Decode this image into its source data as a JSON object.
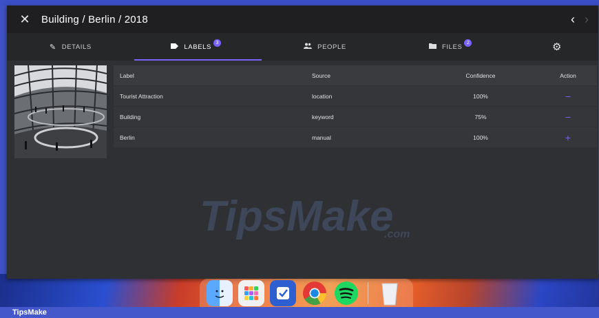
{
  "window": {
    "title": "Building / Berlin / 2018"
  },
  "tabs": [
    {
      "label": "DETAILS",
      "icon": "pencil-icon",
      "badge": ""
    },
    {
      "label": "LABELS",
      "icon": "label-tag-icon",
      "badge": "3"
    },
    {
      "label": "PEOPLE",
      "icon": "people-icon",
      "badge": ""
    },
    {
      "label": "FILES",
      "icon": "folder-icon",
      "badge": "2"
    }
  ],
  "labels_table": {
    "headers": {
      "label": "Label",
      "source": "Source",
      "confidence": "Confidence",
      "action": "Action"
    },
    "rows": [
      {
        "label": "Tourist Attraction",
        "source": "location",
        "confidence": "100%",
        "action": "−"
      },
      {
        "label": "Building",
        "source": "keyword",
        "confidence": "75%",
        "action": "−"
      },
      {
        "label": "Berlin",
        "source": "manual",
        "confidence": "100%",
        "action": "+"
      }
    ]
  },
  "watermark": {
    "main": "TipsMake",
    "suffix": ".com"
  },
  "bottom_bar": {
    "brand": "TipsMake"
  },
  "colors": {
    "accent": "#7b61ff",
    "window_bg": "#2f3033",
    "titlebar_bg": "#1f1f21"
  }
}
